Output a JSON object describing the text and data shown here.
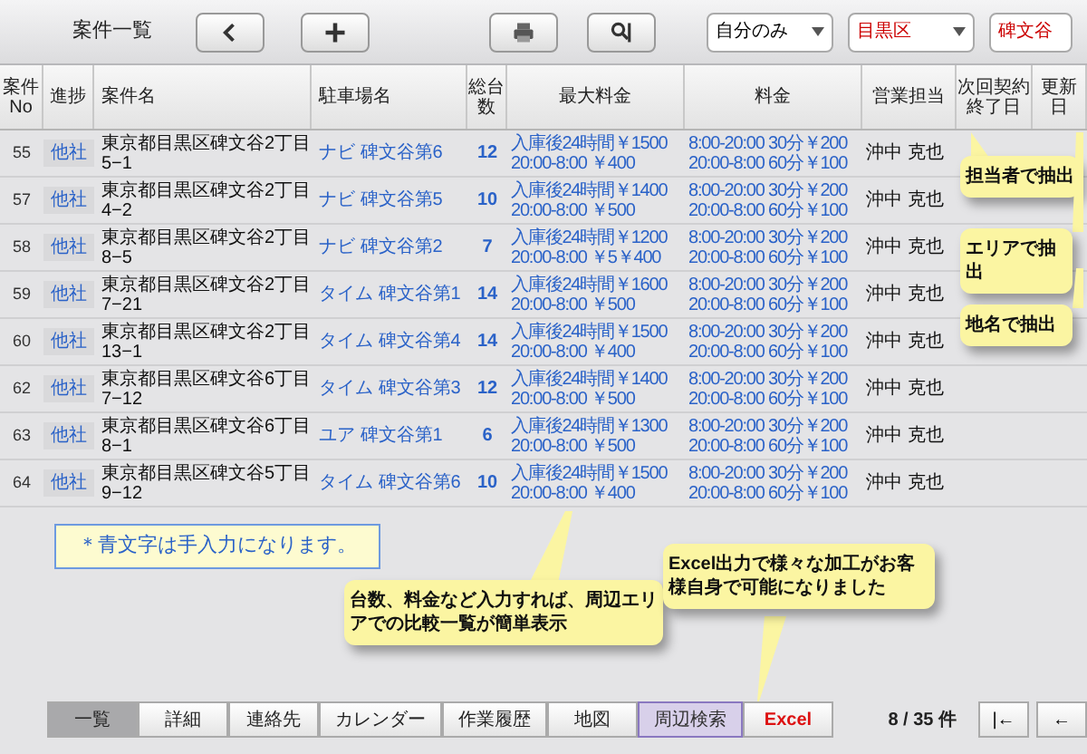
{
  "header": {
    "title": "案件一覧",
    "buttons": [
      {
        "kind": "back"
      },
      {
        "kind": "add"
      },
      {
        "kind": "print"
      },
      {
        "kind": "tools"
      }
    ]
  },
  "filters": [
    {
      "value": "自分のみ",
      "color": "#000000"
    },
    {
      "value": "目黒区",
      "color": "#cc0000"
    },
    {
      "value": "碑文谷",
      "color": "#cc0000"
    }
  ],
  "table": {
    "columns": [
      "案件No",
      "進捗",
      "案件名",
      "駐車場名",
      "総台数",
      "最大料金",
      "料金",
      "営業担当",
      "次回契約終了日",
      "更新日"
    ],
    "rows": [
      {
        "no": "55",
        "status": "他社",
        "name": "東京都目黒区碑文谷2丁目5−1",
        "parking": "ナビ 碑文谷第6",
        "count": "12",
        "max_fee": [
          "入庫後24時間￥1500",
          "20:00-8:00 ￥400"
        ],
        "fee": [
          "8:00-20:00 30分￥200",
          "20:00-8:00 60分￥100"
        ],
        "staff": "沖中 克也"
      },
      {
        "no": "57",
        "status": "他社",
        "name": "東京都目黒区碑文谷2丁目4−2",
        "parking": "ナビ 碑文谷第5",
        "count": "10",
        "max_fee": [
          "入庫後24時間￥1400",
          "20:00-8:00 ￥500"
        ],
        "fee": [
          "8:00-20:00 30分￥200",
          "20:00-8:00 60分￥100"
        ],
        "staff": "沖中 克也"
      },
      {
        "no": "58",
        "status": "他社",
        "name": "東京都目黒区碑文谷2丁目8−5",
        "parking": "ナビ 碑文谷第2",
        "count": "7",
        "max_fee": [
          "入庫後24時間￥1200",
          "20:00-8:00 ￥5￥400"
        ],
        "fee": [
          "8:00-20:00 30分￥200",
          "20:00-8:00 60分￥100"
        ],
        "staff": "沖中 克也"
      },
      {
        "no": "59",
        "status": "他社",
        "name": "東京都目黒区碑文谷2丁目7−21",
        "parking": "タイム 碑文谷第1",
        "count": "14",
        "max_fee": [
          "入庫後24時間￥1600",
          "20:00-8:00 ￥500"
        ],
        "fee": [
          "8:00-20:00 30分￥200",
          "20:00-8:00 60分￥100"
        ],
        "staff": "沖中 克也"
      },
      {
        "no": "60",
        "status": "他社",
        "name": "東京都目黒区碑文谷2丁目13−1",
        "parking": "タイム 碑文谷第4",
        "count": "14",
        "max_fee": [
          "入庫後24時間￥1500",
          "20:00-8:00 ￥400"
        ],
        "fee": [
          "8:00-20:00 30分￥200",
          "20:00-8:00 60分￥100"
        ],
        "staff": "沖中 克也"
      },
      {
        "no": "62",
        "status": "他社",
        "name": "東京都目黒区碑文谷6丁目7−12",
        "parking": "タイム 碑文谷第3",
        "count": "12",
        "max_fee": [
          "入庫後24時間￥1400",
          "20:00-8:00 ￥500"
        ],
        "fee": [
          "8:00-20:00 30分￥200",
          "20:00-8:00 60分￥100"
        ],
        "staff": "沖中 克也"
      },
      {
        "no": "63",
        "status": "他社",
        "name": "東京都目黒区碑文谷6丁目8−1",
        "parking": "ユア 碑文谷第1",
        "count": "6",
        "max_fee": [
          "入庫後24時間￥1300",
          "20:00-8:00 ￥500"
        ],
        "fee": [
          "8:00-20:00 30分￥200",
          "20:00-8:00 60分￥100"
        ],
        "staff": "沖中 克也"
      },
      {
        "no": "64",
        "status": "他社",
        "name": "東京都目黒区碑文谷5丁目9−12",
        "parking": "タイム 碑文谷第6",
        "count": "10",
        "max_fee": [
          "入庫後24時間￥1500",
          "20:00-8:00 ￥400"
        ],
        "fee": [
          "8:00-20:00 30分￥200",
          "20:00-8:00 60分￥100"
        ],
        "staff": "沖中 克也"
      }
    ]
  },
  "note": "＊青文字は手入力になります。",
  "callouts": [
    "担当者で抽出",
    "エリアで抽出",
    "地名で抽出",
    "台数、料金など入力すれば、周辺エリアでの比較一覧が簡単表示",
    "Excel出力で様々な加工がお客様自身で可能になりました"
  ],
  "tabs": [
    {
      "label": "一覧",
      "selected": true,
      "kind": "tab"
    },
    {
      "label": "詳細",
      "selected": false,
      "kind": "tab"
    },
    {
      "label": "連絡先",
      "selected": false,
      "kind": "tab"
    },
    {
      "label": "カレンダー",
      "selected": false,
      "kind": "tab"
    },
    {
      "label": "作業履歴",
      "selected": false,
      "kind": "tab"
    },
    {
      "label": "地図",
      "selected": false,
      "kind": "tab"
    },
    {
      "label": "周辺検索",
      "selected": false,
      "kind": "search"
    },
    {
      "label": "Excel",
      "selected": false,
      "kind": "excel"
    }
  ],
  "pagination": {
    "text": "8 / 35 件",
    "buttons": [
      "|←",
      "←"
    ]
  }
}
